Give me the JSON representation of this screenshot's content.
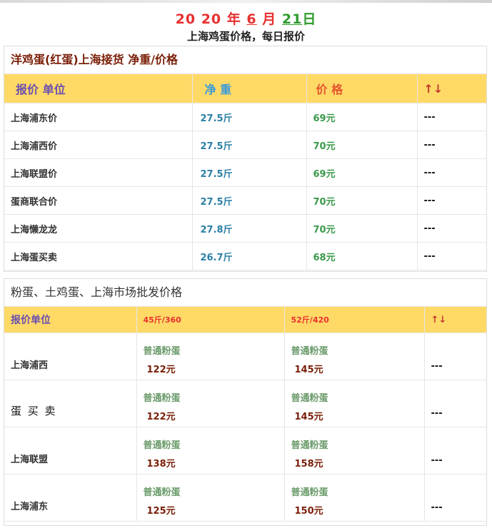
{
  "header": {
    "year_a": "20",
    "year_b": "20",
    "year_char": "年",
    "month": "6",
    "month_char": "月",
    "day": "21",
    "day_char": "日",
    "subtitle": "上海鸡蛋价格，每日报价"
  },
  "section1": {
    "title": "洋鸡蛋(红蛋)上海接货 净重/价格",
    "headers": [
      "报价 单位",
      "净 重",
      "价 格",
      "↑↓"
    ],
    "rows": [
      {
        "name": "上海浦东价",
        "weight": "27.5斤",
        "price": "69元",
        "trend": "---"
      },
      {
        "name": "上海浦西价",
        "weight": "27.5斤",
        "price": "70元",
        "trend": "---"
      },
      {
        "name": "上海联盟价",
        "weight": "27.5斤",
        "price": "69元",
        "trend": "---"
      },
      {
        "name": "蛋商联合价",
        "weight": "27.5斤",
        "price": "70元",
        "trend": "---"
      },
      {
        "name": "上海懒龙龙",
        "weight": "27.8斤",
        "price": "70元",
        "trend": "---"
      },
      {
        "name": "上海蛋买卖",
        "weight": "26.7斤",
        "price": "68元",
        "trend": "---"
      }
    ]
  },
  "section2": {
    "title": "粉蛋、土鸡蛋、上海市场批发价格",
    "headers": [
      "报价单位",
      "45斤/360",
      "52斤/420",
      "↑↓"
    ],
    "rows": [
      {
        "name": "上海浦西",
        "kind_a": "普通粉蛋",
        "price_a": "122元",
        "kind_b": "普通粉蛋",
        "price_b": "145元",
        "trend": "---"
      },
      {
        "name": "蛋 买 卖",
        "kind_a": "普通粉蛋",
        "price_a": "122元",
        "kind_b": "普通粉蛋",
        "price_b": "145元",
        "trend": "---"
      },
      {
        "name": "上海联盟",
        "kind_a": "普通粉蛋",
        "price_a": "138元",
        "kind_b": "普通粉蛋",
        "price_b": "158元",
        "trend": "---"
      },
      {
        "name": "上海浦东",
        "kind_a": "普通粉蛋",
        "price_a": "125元",
        "kind_b": "普通粉蛋",
        "price_b": "150元",
        "trend": "---"
      }
    ]
  }
}
